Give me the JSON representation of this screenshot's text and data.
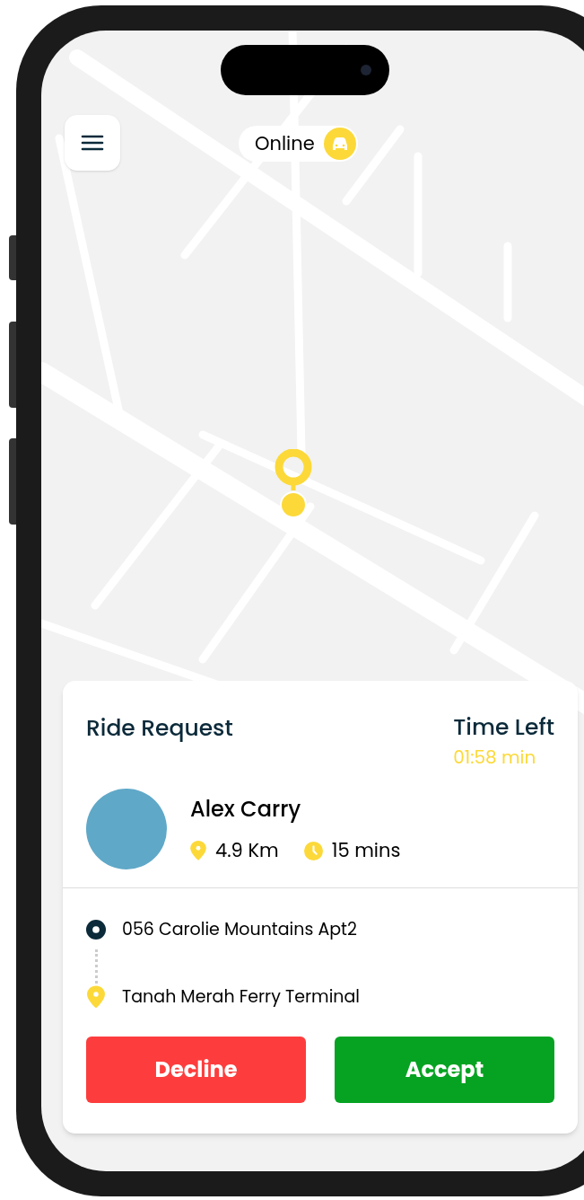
{
  "status_chip": {
    "label": "Online"
  },
  "ride_request": {
    "title": "Ride Request",
    "time_left_label": "Time Left",
    "time_left": "01:58 min",
    "rider": {
      "name": "Alex Carry",
      "distance": "4.9 Km",
      "duration": "15 mins"
    },
    "route": [
      {
        "kind": "pickup",
        "address": "056 Carolie Mountains Apt2"
      },
      {
        "kind": "dropoff",
        "address": "Tanah Merah Ferry Terminal"
      }
    ],
    "actions": [
      {
        "kind": "decline",
        "label": "Decline"
      },
      {
        "kind": "accept",
        "label": "Accept"
      }
    ]
  }
}
